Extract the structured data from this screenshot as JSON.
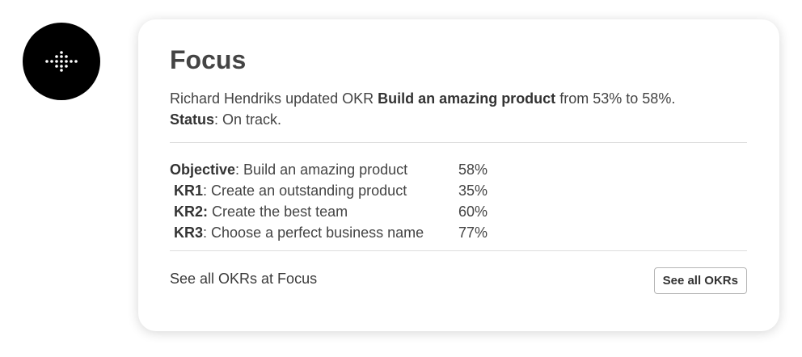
{
  "app": {
    "icon": "dotted-diamond-logo-icon",
    "background_color": "#000000"
  },
  "card": {
    "title": "Focus",
    "message": {
      "actor": "Richard Hendriks",
      "action": "updated OKR",
      "okr_name": "Build an amazing product",
      "from_label": "from",
      "from_value": "53%",
      "to_label": "to",
      "to_value": "58%.",
      "status_label": "Status",
      "status_value": ": On track."
    },
    "rows": [
      {
        "key": "Objective",
        "desc": ": Build an amazing product",
        "value": "58%"
      },
      {
        "key": "KR1",
        "desc": ": Create an outstanding product",
        "value": "35%"
      },
      {
        "key": "KR2:",
        "desc": " Create the best team",
        "value": "60%"
      },
      {
        "key": "KR3",
        "desc": ": Choose a perfect business name",
        "value": "77%"
      }
    ],
    "footer_text": "See all OKRs at Focus",
    "footer_button": "See all OKRs"
  }
}
